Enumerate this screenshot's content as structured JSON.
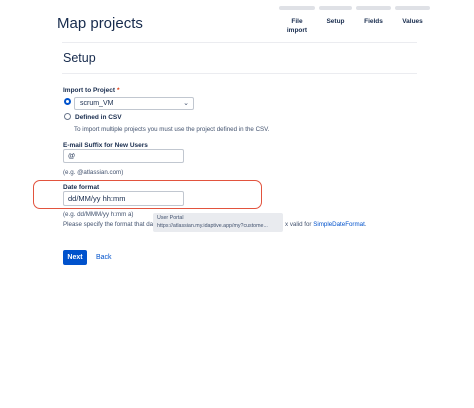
{
  "header": {
    "title": "Map projects"
  },
  "steps": [
    {
      "label_line1": "File",
      "label_line2": "import"
    },
    {
      "label_line1": "Setup",
      "label_line2": ""
    },
    {
      "label_line1": "Fields",
      "label_line2": ""
    },
    {
      "label_line1": "Values",
      "label_line2": ""
    }
  ],
  "section": {
    "title": "Setup"
  },
  "import_to_project": {
    "label": "Import to Project",
    "required_mark": "*",
    "selected_value": "scrum_VM",
    "defined_in_csv_label": "Defined in CSV",
    "helper": "To import multiple projects you must use the project defined in the CSV."
  },
  "email_suffix": {
    "label": "E-mail Suffix for New Users",
    "value": "@",
    "example": "(e.g. @atlassian.com)"
  },
  "date_format": {
    "label": "Date format",
    "value": "dd/MM/yy hh:mm",
    "example": "(e.g. dd/MMM/yy h:mm a)",
    "help_prefix": "Please specify the format that da",
    "help_suffix": "x valid for",
    "help_link": "SimpleDateFormat",
    "help_end": "."
  },
  "tooltip": {
    "title": "User Portal",
    "url": "https://atlassian.my.idaptive.app/my?custome..."
  },
  "actions": {
    "next_label": "Next",
    "back_label": "Back"
  },
  "colors": {
    "accent": "#0052cc",
    "highlight": "#e2533e"
  }
}
